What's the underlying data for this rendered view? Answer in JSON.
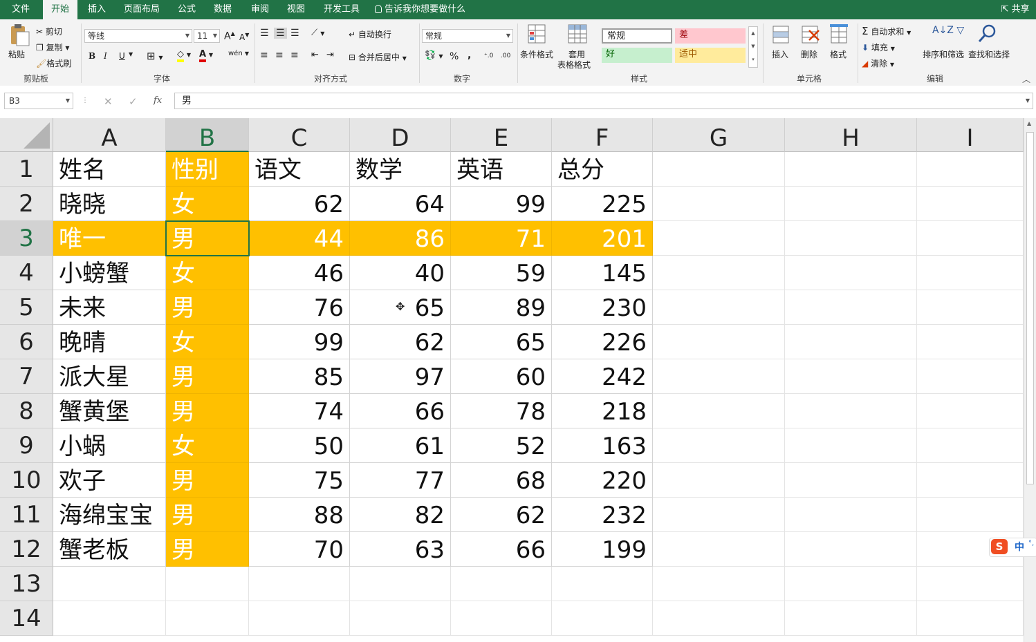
{
  "tabs": {
    "file": "文件",
    "home": "开始",
    "insert": "插入",
    "page_layout": "页面布局",
    "formulas": "公式",
    "data": "数据",
    "review": "审阅",
    "view": "视图",
    "developer": "开发工具",
    "tell_me": "告诉我你想要做什么",
    "share": "共享"
  },
  "ribbon": {
    "clipboard": {
      "paste": "粘贴",
      "cut": "剪切",
      "copy": "复制",
      "format_painter": "格式刷",
      "label": "剪贴板"
    },
    "font": {
      "font_name": "等线",
      "font_size": "11",
      "bold": "B",
      "italic": "I",
      "underline": "U",
      "label": "字体"
    },
    "alignment": {
      "wrap_text": "自动换行",
      "merge_center": "合并后居中",
      "label": "对齐方式"
    },
    "number": {
      "format": "常规",
      "percent": "%",
      "comma": ",",
      "label": "数字"
    },
    "styles": {
      "conditional_format": "条件格式",
      "format_as_table_1": "套用",
      "format_as_table_2": "表格格式",
      "normal": "常规",
      "bad": "差",
      "good": "好",
      "neutral": "适中",
      "label": "样式"
    },
    "cells": {
      "insert": "插入",
      "delete": "删除",
      "format": "格式",
      "label": "单元格"
    },
    "editing": {
      "autosum": "自动求和",
      "fill": "填充",
      "clear": "清除",
      "sort_filter": "排序和筛选",
      "find_select": "查找和选择",
      "label": "编辑"
    }
  },
  "formula_bar": {
    "name_box": "B3",
    "fx": "fx",
    "content": "男"
  },
  "columns": [
    "A",
    "B",
    "C",
    "D",
    "E",
    "F",
    "G",
    "H",
    "I"
  ],
  "rows": [
    "1",
    "2",
    "3",
    "4",
    "5",
    "6",
    "7",
    "8",
    "9",
    "10",
    "11",
    "12",
    "13",
    "14"
  ],
  "table": {
    "headers": [
      "姓名",
      "性别",
      "语文",
      "数学",
      "英语",
      "总分"
    ],
    "data": [
      [
        "晓晓",
        "女",
        "62",
        "64",
        "99",
        "225"
      ],
      [
        "唯一",
        "男",
        "44",
        "86",
        "71",
        "201"
      ],
      [
        "小螃蟹",
        "女",
        "46",
        "40",
        "59",
        "145"
      ],
      [
        "未来",
        "男",
        "76",
        "65",
        "89",
        "230"
      ],
      [
        "晚晴",
        "女",
        "99",
        "62",
        "65",
        "226"
      ],
      [
        "派大星",
        "男",
        "85",
        "97",
        "60",
        "242"
      ],
      [
        "蟹黄堡",
        "男",
        "74",
        "66",
        "78",
        "218"
      ],
      [
        "小蜗",
        "女",
        "50",
        "61",
        "52",
        "163"
      ],
      [
        "欢子",
        "男",
        "75",
        "77",
        "68",
        "220"
      ],
      [
        "海绵宝宝",
        "男",
        "88",
        "82",
        "62",
        "232"
      ],
      [
        "蟹老板",
        "男",
        "70",
        "63",
        "66",
        "199"
      ]
    ]
  },
  "ime": {
    "label": "中"
  },
  "colors": {
    "accent": "#217346",
    "highlight": "#ffc000"
  }
}
